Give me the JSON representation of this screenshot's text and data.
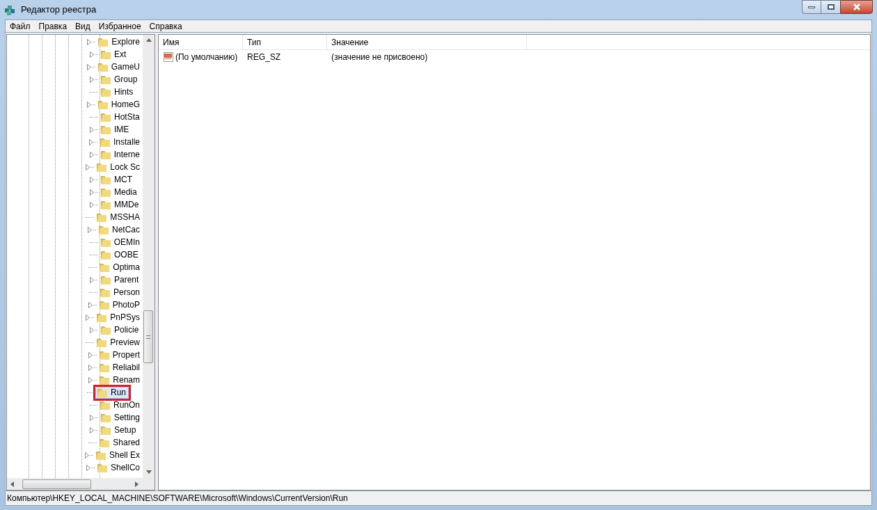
{
  "window": {
    "title": "Редактор реестра"
  },
  "menu": [
    "Файл",
    "Правка",
    "Вид",
    "Избранное",
    "Справка"
  ],
  "tree": [
    {
      "label": "Explore",
      "expandable": true,
      "selected": false,
      "highlighted": false
    },
    {
      "label": "Ext",
      "expandable": true,
      "selected": false,
      "highlighted": false
    },
    {
      "label": "GameU",
      "expandable": true,
      "selected": false,
      "highlighted": false
    },
    {
      "label": "Group",
      "expandable": true,
      "selected": false,
      "highlighted": false
    },
    {
      "label": "Hints",
      "expandable": false,
      "selected": false,
      "highlighted": false
    },
    {
      "label": "HomeG",
      "expandable": true,
      "selected": false,
      "highlighted": false
    },
    {
      "label": "HotSta",
      "expandable": false,
      "selected": false,
      "highlighted": false
    },
    {
      "label": "IME",
      "expandable": true,
      "selected": false,
      "highlighted": false
    },
    {
      "label": "Installe",
      "expandable": true,
      "selected": false,
      "highlighted": false
    },
    {
      "label": "Interne",
      "expandable": true,
      "selected": false,
      "highlighted": false
    },
    {
      "label": "Lock Sc",
      "expandable": true,
      "selected": false,
      "highlighted": false
    },
    {
      "label": "MCT",
      "expandable": true,
      "selected": false,
      "highlighted": false
    },
    {
      "label": "Media",
      "expandable": true,
      "selected": false,
      "highlighted": false
    },
    {
      "label": "MMDe",
      "expandable": true,
      "selected": false,
      "highlighted": false
    },
    {
      "label": "MSSHA",
      "expandable": false,
      "selected": false,
      "highlighted": false
    },
    {
      "label": "NetCac",
      "expandable": true,
      "selected": false,
      "highlighted": false
    },
    {
      "label": "OEMIn",
      "expandable": false,
      "selected": false,
      "highlighted": false
    },
    {
      "label": "OOBE",
      "expandable": false,
      "selected": false,
      "highlighted": false
    },
    {
      "label": "Optima",
      "expandable": false,
      "selected": false,
      "highlighted": false
    },
    {
      "label": "Parent",
      "expandable": true,
      "selected": false,
      "highlighted": false
    },
    {
      "label": "Person",
      "expandable": false,
      "selected": false,
      "highlighted": false
    },
    {
      "label": "PhotoP",
      "expandable": true,
      "selected": false,
      "highlighted": false
    },
    {
      "label": "PnPSys",
      "expandable": true,
      "selected": false,
      "highlighted": false
    },
    {
      "label": "Policie",
      "expandable": true,
      "selected": false,
      "highlighted": false
    },
    {
      "label": "Preview",
      "expandable": false,
      "selected": false,
      "highlighted": false
    },
    {
      "label": "Propert",
      "expandable": true,
      "selected": false,
      "highlighted": false
    },
    {
      "label": "Reliabil",
      "expandable": true,
      "selected": false,
      "highlighted": false
    },
    {
      "label": "Renam",
      "expandable": true,
      "selected": false,
      "highlighted": false
    },
    {
      "label": "Run",
      "expandable": false,
      "selected": true,
      "highlighted": true
    },
    {
      "label": "RunOn",
      "expandable": false,
      "selected": false,
      "highlighted": false
    },
    {
      "label": "Setting",
      "expandable": true,
      "selected": false,
      "highlighted": false
    },
    {
      "label": "Setup",
      "expandable": true,
      "selected": false,
      "highlighted": false
    },
    {
      "label": "Shared",
      "expandable": false,
      "selected": false,
      "highlighted": false
    },
    {
      "label": "Shell Ex",
      "expandable": true,
      "selected": false,
      "highlighted": false
    },
    {
      "label": "ShellCo",
      "expandable": true,
      "selected": false,
      "highlighted": false
    }
  ],
  "table": {
    "columns": [
      "Имя",
      "Тип",
      "Значение"
    ],
    "rows": [
      [
        "(По умолчанию)",
        "REG_SZ",
        "(значение не присвоено)"
      ]
    ]
  },
  "status_bar": "Компьютер\\HKEY_LOCAL_MACHINE\\SOFTWARE\\Microsoft\\Windows\\CurrentVersion\\Run"
}
